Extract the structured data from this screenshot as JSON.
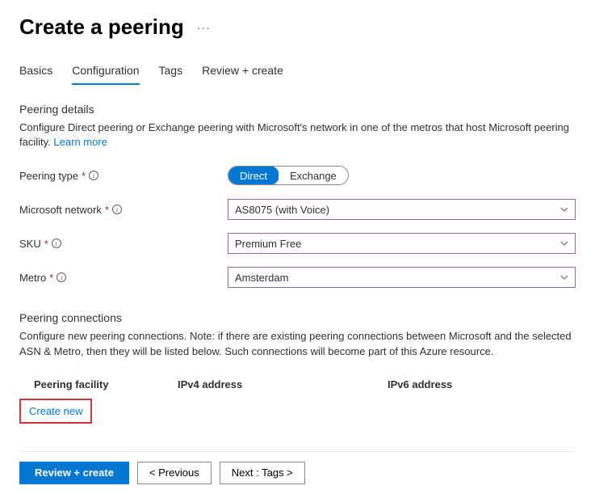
{
  "header": {
    "title": "Create a peering"
  },
  "tabs": {
    "basics": "Basics",
    "configuration": "Configuration",
    "tags": "Tags",
    "review": "Review + create",
    "active": "configuration"
  },
  "details": {
    "heading": "Peering details",
    "description": "Configure Direct peering or Exchange peering with Microsoft's network in one of the metros that host Microsoft peering facility. ",
    "learn_more": "Learn more"
  },
  "form": {
    "peering_type": {
      "label": "Peering type",
      "opt1": "Direct",
      "opt2": "Exchange"
    },
    "network": {
      "label": "Microsoft network",
      "value": "AS8075 (with Voice)"
    },
    "sku": {
      "label": "SKU",
      "value": "Premium Free"
    },
    "metro": {
      "label": "Metro",
      "value": "Amsterdam"
    }
  },
  "connections": {
    "heading": "Peering connections",
    "description": "Configure new peering connections. Note: if there are existing peering connections between Microsoft and the selected ASN & Metro, then they will be listed below. Such connections will become part of this Azure resource.",
    "col_facility": "Peering facility",
    "col_ipv4": "IPv4 address",
    "col_ipv6": "IPv6 address",
    "create_new": "Create new"
  },
  "footer": {
    "review": "Review + create",
    "previous": "< Previous",
    "next": "Next : Tags >"
  }
}
